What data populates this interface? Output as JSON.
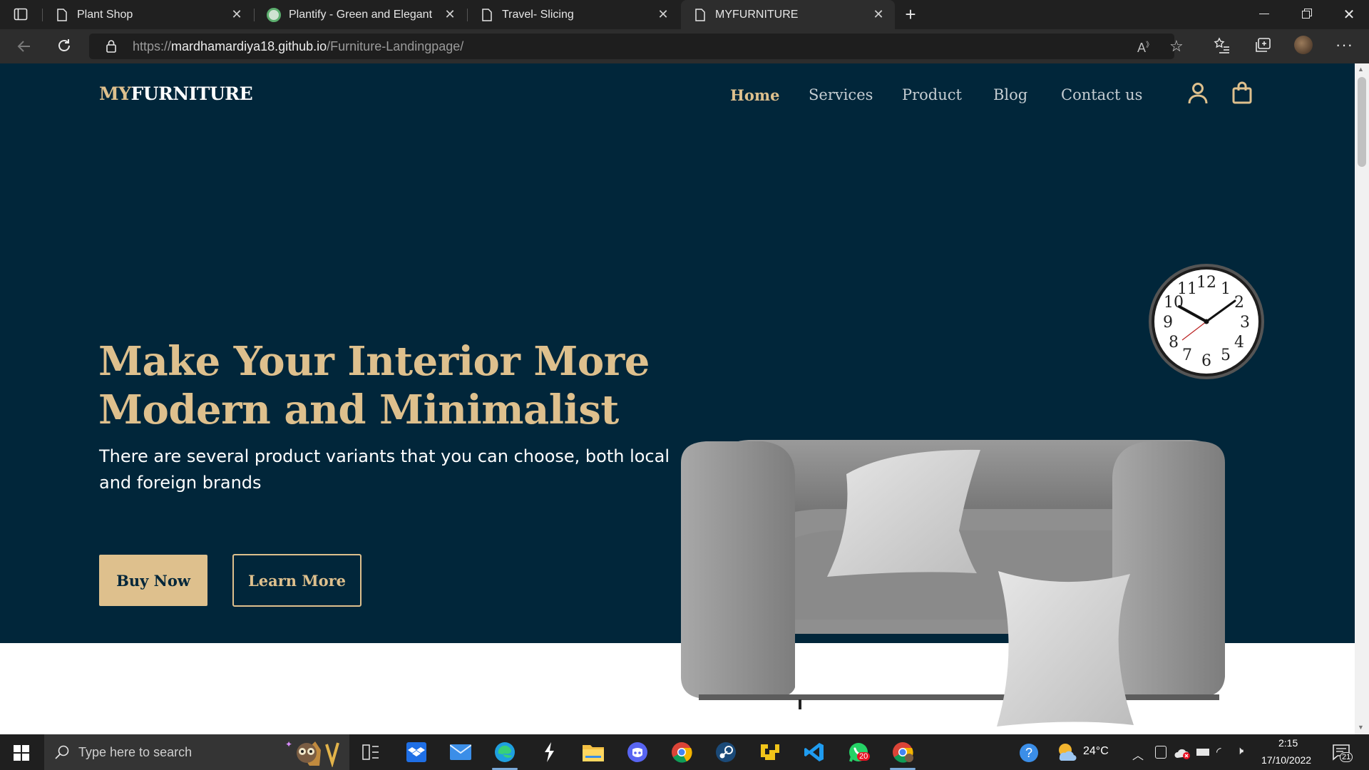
{
  "browser": {
    "tabs": [
      {
        "title": "Plant Shop"
      },
      {
        "title": "Plantify - Green and Elegant"
      },
      {
        "title": "Travel- Slicing"
      },
      {
        "title": "MYFURNITURE"
      }
    ],
    "url_prefix": "https://",
    "url_domain": "mardhamardiya18.github.io",
    "url_path": "/Furniture-Landingpage/"
  },
  "site": {
    "logo_my": "MY",
    "logo_furniture": "FURNITURE",
    "nav": [
      "Home",
      "Services",
      "Product",
      "Blog",
      "Contact us"
    ],
    "headline_1": "Make Your Interior More",
    "headline_2": "Modern and Minimalist",
    "subtext": "There are several product variants that you can choose, both local and foreign brands",
    "buy_label": "Buy Now",
    "learn_label": "Learn More",
    "colors": {
      "hero_bg": "#01263a",
      "accent": "#dec08d"
    }
  },
  "clock": {
    "numbers": [
      "12",
      "1",
      "2",
      "3",
      "4",
      "5",
      "6",
      "7",
      "8",
      "9",
      "10",
      "11"
    ]
  },
  "taskbar": {
    "search_placeholder": "Type here to search",
    "temperature": "24°C",
    "time": "2:15",
    "date": "17/10/2022",
    "whatsapp_badge": "20",
    "notification_count": "21"
  }
}
